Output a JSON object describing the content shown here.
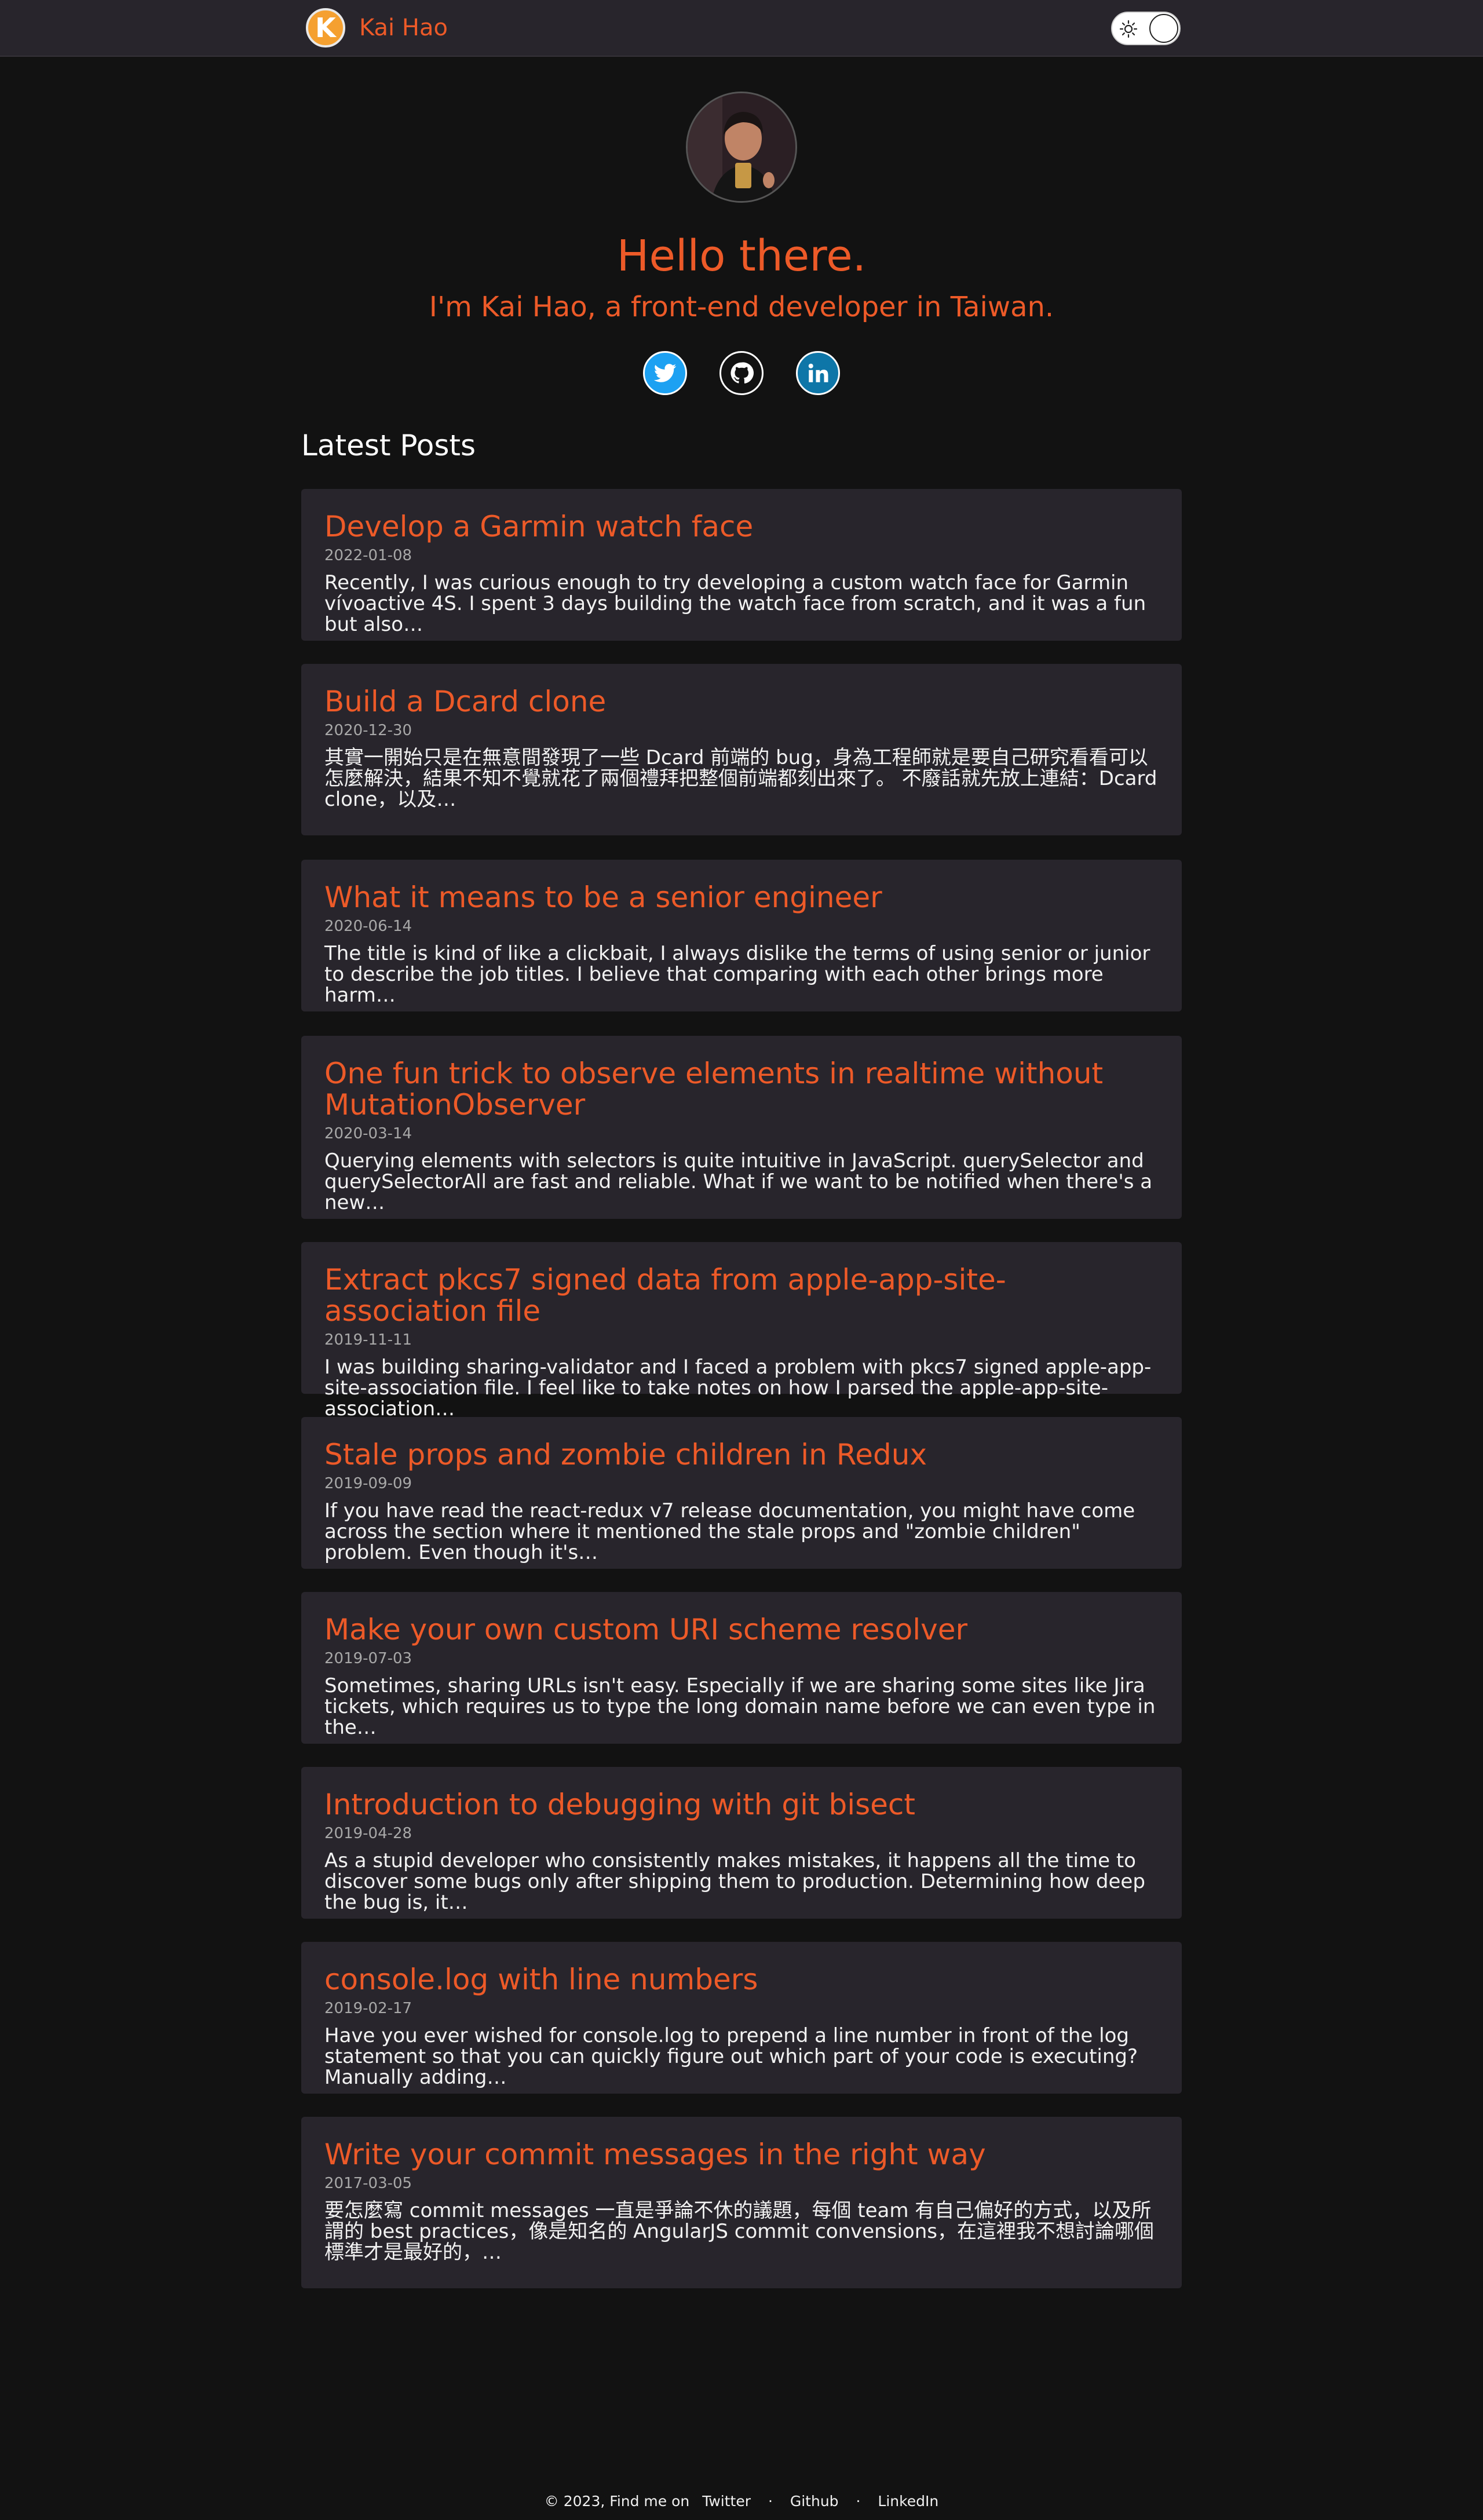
{
  "header": {
    "logo_letter": "K",
    "site_title": "Kai Hao"
  },
  "hero": {
    "heading": "Hello there.",
    "intro": "I'm Kai Hao, a front-end developer in Taiwan.",
    "social": [
      {
        "name": "twitter",
        "icon": "twitter-icon",
        "color": "#1da1f2"
      },
      {
        "name": "github",
        "icon": "github-icon",
        "color": "#121212"
      },
      {
        "name": "linkedin",
        "icon": "linkedin-icon",
        "color": "#0e76a8"
      }
    ]
  },
  "latest_posts_title": "Latest Posts",
  "posts": [
    {
      "title": "Develop a Garmin watch face",
      "date": "2022-01-08",
      "excerpt": "Recently, I was curious enough to try developing a custom watch face for Garmin vívoactive 4S. I spent 3 days building the watch face from scratch, and it was a fun but also…"
    },
    {
      "title": "Build a Dcard clone",
      "date": "2020-12-30",
      "excerpt": "其實一開始只是在無意間發現了一些 Dcard 前端的 bug，身為工程師就是要自己研究看看可以怎麼解決，結果不知不覺就花了兩個禮拜把整個前端都刻出來了。 不廢話就先放上連結：Dcard clone，以及…"
    },
    {
      "title": "What it means to be a senior engineer",
      "date": "2020-06-14",
      "excerpt": "The title is kind of like a clickbait, I always dislike the terms of using senior or junior to describe the job titles. I believe that comparing with each other brings more harm…"
    },
    {
      "title": "One fun trick to observe elements in realtime without MutationObserver",
      "date": "2020-03-14",
      "excerpt": "Querying elements with selectors is quite intuitive in JavaScript. querySelector and querySelectorAll are fast and reliable. What if we want to be notified when there's a new…"
    },
    {
      "title": "Extract pkcs7 signed data from apple-app-site-association file",
      "date": "2019-11-11",
      "excerpt": "I was building sharing-validator and I faced a problem with pkcs7 signed apple-app-site-association file. I feel like to take notes on how I parsed the apple-app-site-association…"
    },
    {
      "title": "Stale props and zombie children in Redux",
      "date": "2019-09-09",
      "excerpt": "If you have read the react-redux v7 release documentation, you might have come across the section where it mentioned the stale props and \"zombie children\" problem. Even though it's…"
    },
    {
      "title": "Make your own custom URI scheme resolver",
      "date": "2019-07-03",
      "excerpt": "Sometimes, sharing URLs isn't easy. Especially if we are sharing some sites like Jira tickets, which requires us to type the long domain name before we can even type in the…"
    },
    {
      "title": "Introduction to debugging with git bisect",
      "date": "2019-04-28",
      "excerpt": "As a stupid developer who consistently makes mistakes, it happens all the time to discover some bugs only after shipping them to production. Determining how deep the bug is, it…"
    },
    {
      "title": "console.log with line numbers",
      "date": "2019-02-17",
      "excerpt": "Have you ever wished for console.log to prepend a line number in front of the log statement so that you can quickly figure out which part of your code is executing? Manually adding…"
    },
    {
      "title": "Write your commit messages in the right way",
      "date": "2017-03-05",
      "excerpt": "要怎麼寫 commit messages 一直是爭論不休的議題，每個 team 有自己偏好的方式，以及所謂的 best practices，像是知名的 AngularJS commit convensions，在這裡我不想討論哪個標準才是最好的，…"
    }
  ],
  "footer": {
    "copyright": "© 2023, Find me on",
    "links": [
      "Twitter",
      "Github",
      "LinkedIn"
    ],
    "separator": "·"
  },
  "colors": {
    "accent": "#ed5a28",
    "background": "#121212",
    "card": "#28252c"
  }
}
